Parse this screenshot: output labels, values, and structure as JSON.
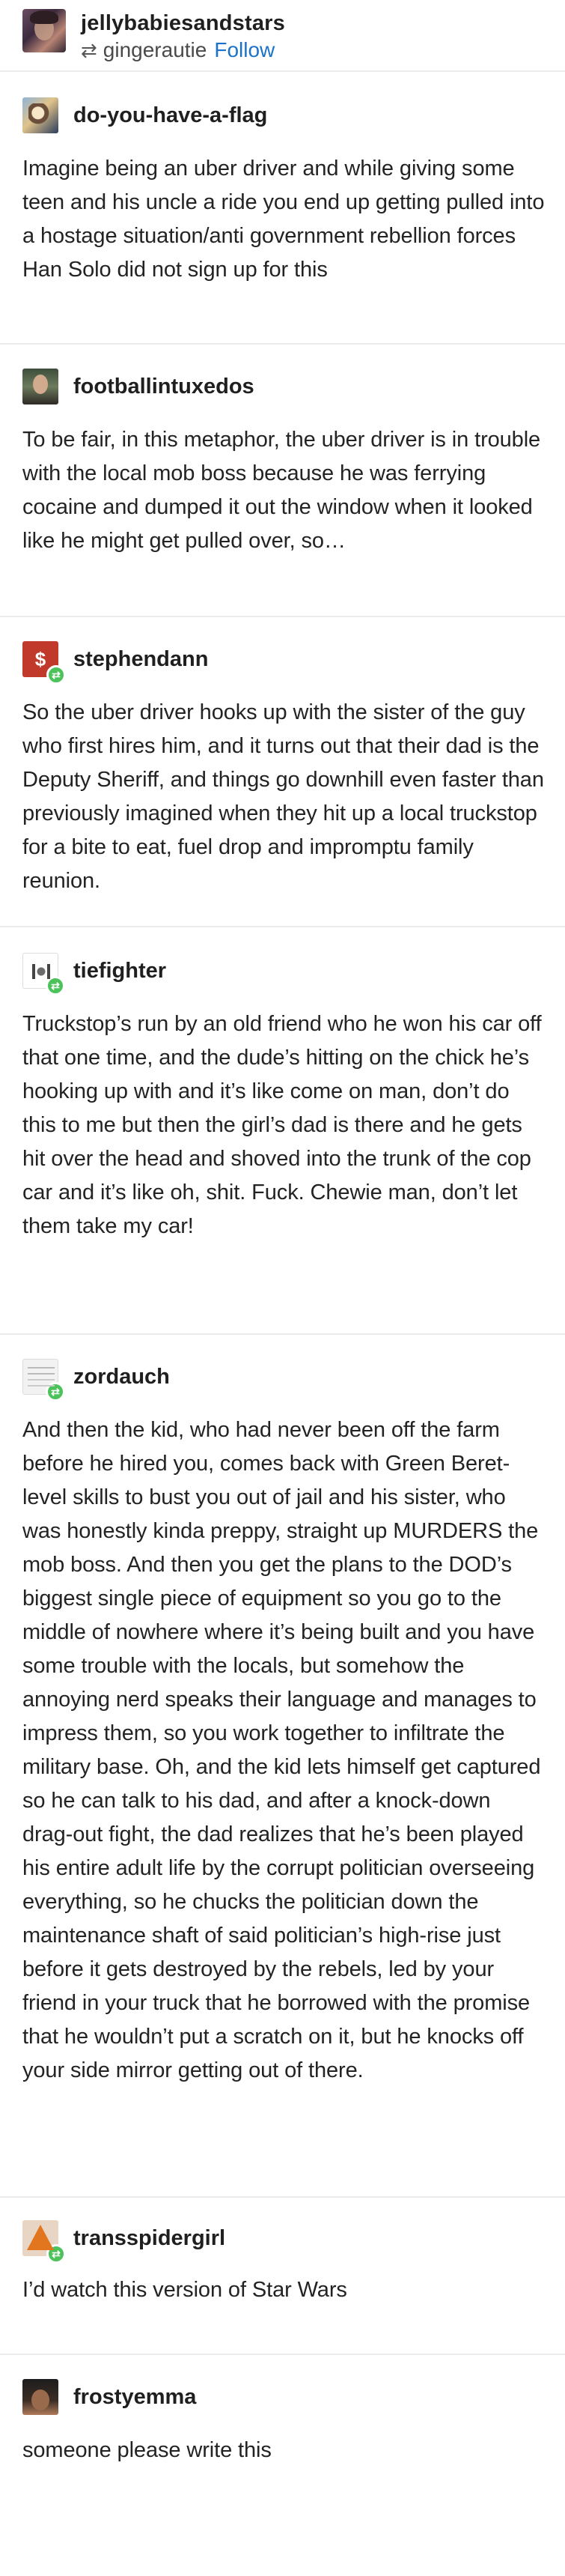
{
  "header": {
    "username": "jellybabiesandstars",
    "reblogged_from": "gingerautie",
    "follow_label": "Follow"
  },
  "posts": [
    {
      "username": "do-you-have-a-flag",
      "paragraphs": [
        "Imagine being an uber driver and while giving some teen and his uncle a ride you end up getting pulled into a hostage situation/anti government rebellion forces",
        "Han Solo did not sign up for this"
      ]
    },
    {
      "username": "footballintuxedos",
      "paragraphs": [
        "To be fair, in this metaphor, the uber driver is in trouble with the local mob boss because he was ferrying cocaine and dumped it out the window when it looked like he might get pulled over, so…"
      ]
    },
    {
      "username": "stephendann",
      "paragraphs": [
        "So the uber driver hooks up with the sister of the guy who first hires him, and it turns out that their dad is the Deputy Sheriff, and things go downhill even faster than previously imagined when they hit up a local truckstop for a bite to eat, fuel drop and impromptu family reunion."
      ]
    },
    {
      "username": "tiefighter",
      "paragraphs": [
        "Truckstop’s run by an old friend who he won his car off that one time, and the dude’s hitting on the chick he’s hooking up with and it’s like come on man, don’t do this to me but then the girl’s dad is there and he gets hit over the head and shoved into the trunk of the cop car and it’s like oh, shit. Fuck. Chewie man, don’t let them take my car!"
      ]
    },
    {
      "username": "zordauch",
      "paragraphs": [
        "And then the kid, who had never been off the farm before he hired you, comes back with Green Beret-level skills to bust you out of jail and his sister, who was honestly kinda preppy, straight up MURDERS the mob boss. And then you get the plans to the DOD’s biggest single piece of equipment so you go to the middle of nowhere where it’s being built and you have some trouble with the locals, but somehow the annoying nerd speaks their language and manages to impress them, so you work together to infiltrate the military base. Oh, and the kid lets himself get captured so he can talk to his dad, and after a knock-down drag-out fight, the dad realizes that he’s been played his entire adult life by the corrupt politician overseeing everything, so he chucks the politician down the maintenance shaft of said politician’s high-rise just before it gets destroyed by the rebels, led by your friend in your truck that he borrowed with the promise that he wouldn’t put a scratch on it, but he knocks off your side mirror getting out of there."
      ]
    },
    {
      "username": "transspidergirl",
      "paragraphs": [
        "I’d watch this version of Star Wars"
      ]
    },
    {
      "username": "frostyemma",
      "paragraphs": [
        "someone please write this"
      ]
    }
  ]
}
